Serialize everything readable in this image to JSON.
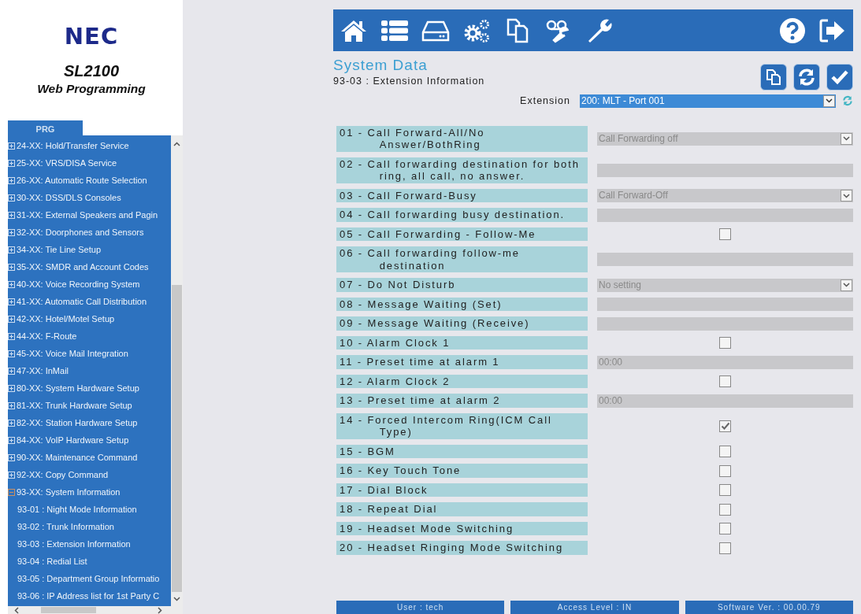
{
  "sidebar": {
    "logo": "NEC",
    "product": "SL2100",
    "subtitle": "Web Programming",
    "tab": "PRG",
    "tree": [
      {
        "label": "24-XX: Hold/Transfer Service",
        "expanded": false
      },
      {
        "label": "25-XX: VRS/DISA Service",
        "expanded": false
      },
      {
        "label": "26-XX: Automatic Route Selection",
        "expanded": false
      },
      {
        "label": "30-XX: DSS/DLS Consoles",
        "expanded": false
      },
      {
        "label": "31-XX: External Speakers and Pagin",
        "expanded": false
      },
      {
        "label": "32-XX: Doorphones and Sensors",
        "expanded": false
      },
      {
        "label": "34-XX: Tie Line Setup",
        "expanded": false
      },
      {
        "label": "35-XX: SMDR and Account Codes",
        "expanded": false
      },
      {
        "label": "40-XX: Voice Recording System",
        "expanded": false
      },
      {
        "label": "41-XX: Automatic Call Distribution",
        "expanded": false
      },
      {
        "label": "42-XX: Hotel/Motel Setup",
        "expanded": false
      },
      {
        "label": "44-XX: F-Route",
        "expanded": false
      },
      {
        "label": "45-XX: Voice Mail Integration",
        "expanded": false
      },
      {
        "label": "47-XX: InMail",
        "expanded": false
      },
      {
        "label": "80-XX: System Hardware Setup",
        "expanded": false
      },
      {
        "label": "81-XX: Trunk Hardware Setup",
        "expanded": false
      },
      {
        "label": "82-XX: Station Hardware Setup",
        "expanded": false
      },
      {
        "label": "84-XX: VoIP Hardware Setup",
        "expanded": false
      },
      {
        "label": "90-XX: Maintenance Command",
        "expanded": false
      },
      {
        "label": "92-XX: Copy Command",
        "expanded": false
      },
      {
        "label": "93-XX: System Information",
        "expanded": true,
        "children": [
          {
            "label": "93-01 : Night Mode Information"
          },
          {
            "label": "93-02 : Trunk Information"
          },
          {
            "label": "93-03 : Extension Information"
          },
          {
            "label": "93-04 : Redial List"
          },
          {
            "label": "93-05 : Department Group Informatio"
          },
          {
            "label": "93-06 : IP Address list for 1st Party C"
          }
        ]
      }
    ]
  },
  "page": {
    "title": "System Data",
    "subtitle": "93-03 : Extension Information",
    "extension_label": "Extension",
    "extension_value": "200: MLT - Port 001"
  },
  "rows": [
    {
      "label": "01 - Call Forward-All/No Answer/BothRing",
      "kind": "select",
      "value": "Call Forwarding off"
    },
    {
      "label": "02 - Call forwarding destination for both ring, all call, no answer.",
      "kind": "text"
    },
    {
      "label": "03 - Call Forward-Busy",
      "kind": "select",
      "value": "Call Forward-Off"
    },
    {
      "label": "04 - Call forwarding busy destination.",
      "kind": "text"
    },
    {
      "label": "05 - Call Forwarding - Follow-Me",
      "kind": "checkbox",
      "checked": false
    },
    {
      "label": "06 - Call forwarding follow-me destination",
      "kind": "text"
    },
    {
      "label": "07 - Do Not Disturb",
      "kind": "select",
      "value": "No setting"
    },
    {
      "label": "08 - Message Waiting (Set)",
      "kind": "text"
    },
    {
      "label": "09 - Message Waiting (Receive)",
      "kind": "text"
    },
    {
      "label": "10 - Alarm Clock 1",
      "kind": "checkbox",
      "checked": false
    },
    {
      "label": "11 - Preset time at alarm 1",
      "kind": "text",
      "value": "00:00"
    },
    {
      "label": "12 - Alarm Clock 2",
      "kind": "checkbox",
      "checked": false
    },
    {
      "label": "13 - Preset time at alarm 2",
      "kind": "text",
      "value": "00:00"
    },
    {
      "label": "14 - Forced Intercom Ring(ICM Call Type)",
      "kind": "checkbox",
      "checked": true
    },
    {
      "label": "15 - BGM",
      "kind": "checkbox",
      "checked": false
    },
    {
      "label": "16 - Key Touch Tone",
      "kind": "checkbox",
      "checked": false
    },
    {
      "label": "17 - Dial Block",
      "kind": "checkbox",
      "checked": false
    },
    {
      "label": "18 - Repeat Dial",
      "kind": "checkbox",
      "checked": false
    },
    {
      "label": "19 - Headset Mode Switching",
      "kind": "checkbox",
      "checked": false
    },
    {
      "label": "20 - Headset Ringing Mode Switching",
      "kind": "checkbox",
      "checked": false
    }
  ],
  "status_bar": [
    "User : tech",
    "Access Level : IN",
    "Software Ver. : 00.00.79"
  ]
}
